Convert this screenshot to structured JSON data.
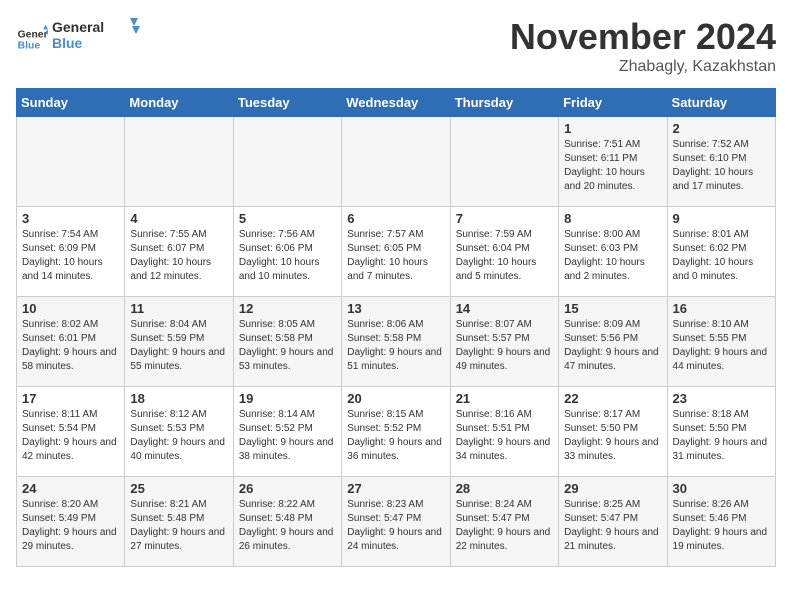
{
  "logo": {
    "line1": "General",
    "line2": "Blue"
  },
  "title": "November 2024",
  "location": "Zhabagly, Kazakhstan",
  "headers": [
    "Sunday",
    "Monday",
    "Tuesday",
    "Wednesday",
    "Thursday",
    "Friday",
    "Saturday"
  ],
  "weeks": [
    [
      {
        "day": "",
        "detail": ""
      },
      {
        "day": "",
        "detail": ""
      },
      {
        "day": "",
        "detail": ""
      },
      {
        "day": "",
        "detail": ""
      },
      {
        "day": "",
        "detail": ""
      },
      {
        "day": "1",
        "detail": "Sunrise: 7:51 AM\nSunset: 6:11 PM\nDaylight: 10 hours and 20 minutes."
      },
      {
        "day": "2",
        "detail": "Sunrise: 7:52 AM\nSunset: 6:10 PM\nDaylight: 10 hours and 17 minutes."
      }
    ],
    [
      {
        "day": "3",
        "detail": "Sunrise: 7:54 AM\nSunset: 6:09 PM\nDaylight: 10 hours and 14 minutes."
      },
      {
        "day": "4",
        "detail": "Sunrise: 7:55 AM\nSunset: 6:07 PM\nDaylight: 10 hours and 12 minutes."
      },
      {
        "day": "5",
        "detail": "Sunrise: 7:56 AM\nSunset: 6:06 PM\nDaylight: 10 hours and 10 minutes."
      },
      {
        "day": "6",
        "detail": "Sunrise: 7:57 AM\nSunset: 6:05 PM\nDaylight: 10 hours and 7 minutes."
      },
      {
        "day": "7",
        "detail": "Sunrise: 7:59 AM\nSunset: 6:04 PM\nDaylight: 10 hours and 5 minutes."
      },
      {
        "day": "8",
        "detail": "Sunrise: 8:00 AM\nSunset: 6:03 PM\nDaylight: 10 hours and 2 minutes."
      },
      {
        "day": "9",
        "detail": "Sunrise: 8:01 AM\nSunset: 6:02 PM\nDaylight: 10 hours and 0 minutes."
      }
    ],
    [
      {
        "day": "10",
        "detail": "Sunrise: 8:02 AM\nSunset: 6:01 PM\nDaylight: 9 hours and 58 minutes."
      },
      {
        "day": "11",
        "detail": "Sunrise: 8:04 AM\nSunset: 5:59 PM\nDaylight: 9 hours and 55 minutes."
      },
      {
        "day": "12",
        "detail": "Sunrise: 8:05 AM\nSunset: 5:58 PM\nDaylight: 9 hours and 53 minutes."
      },
      {
        "day": "13",
        "detail": "Sunrise: 8:06 AM\nSunset: 5:58 PM\nDaylight: 9 hours and 51 minutes."
      },
      {
        "day": "14",
        "detail": "Sunrise: 8:07 AM\nSunset: 5:57 PM\nDaylight: 9 hours and 49 minutes."
      },
      {
        "day": "15",
        "detail": "Sunrise: 8:09 AM\nSunset: 5:56 PM\nDaylight: 9 hours and 47 minutes."
      },
      {
        "day": "16",
        "detail": "Sunrise: 8:10 AM\nSunset: 5:55 PM\nDaylight: 9 hours and 44 minutes."
      }
    ],
    [
      {
        "day": "17",
        "detail": "Sunrise: 8:11 AM\nSunset: 5:54 PM\nDaylight: 9 hours and 42 minutes."
      },
      {
        "day": "18",
        "detail": "Sunrise: 8:12 AM\nSunset: 5:53 PM\nDaylight: 9 hours and 40 minutes."
      },
      {
        "day": "19",
        "detail": "Sunrise: 8:14 AM\nSunset: 5:52 PM\nDaylight: 9 hours and 38 minutes."
      },
      {
        "day": "20",
        "detail": "Sunrise: 8:15 AM\nSunset: 5:52 PM\nDaylight: 9 hours and 36 minutes."
      },
      {
        "day": "21",
        "detail": "Sunrise: 8:16 AM\nSunset: 5:51 PM\nDaylight: 9 hours and 34 minutes."
      },
      {
        "day": "22",
        "detail": "Sunrise: 8:17 AM\nSunset: 5:50 PM\nDaylight: 9 hours and 33 minutes."
      },
      {
        "day": "23",
        "detail": "Sunrise: 8:18 AM\nSunset: 5:50 PM\nDaylight: 9 hours and 31 minutes."
      }
    ],
    [
      {
        "day": "24",
        "detail": "Sunrise: 8:20 AM\nSunset: 5:49 PM\nDaylight: 9 hours and 29 minutes."
      },
      {
        "day": "25",
        "detail": "Sunrise: 8:21 AM\nSunset: 5:48 PM\nDaylight: 9 hours and 27 minutes."
      },
      {
        "day": "26",
        "detail": "Sunrise: 8:22 AM\nSunset: 5:48 PM\nDaylight: 9 hours and 26 minutes."
      },
      {
        "day": "27",
        "detail": "Sunrise: 8:23 AM\nSunset: 5:47 PM\nDaylight: 9 hours and 24 minutes."
      },
      {
        "day": "28",
        "detail": "Sunrise: 8:24 AM\nSunset: 5:47 PM\nDaylight: 9 hours and 22 minutes."
      },
      {
        "day": "29",
        "detail": "Sunrise: 8:25 AM\nSunset: 5:47 PM\nDaylight: 9 hours and 21 minutes."
      },
      {
        "day": "30",
        "detail": "Sunrise: 8:26 AM\nSunset: 5:46 PM\nDaylight: 9 hours and 19 minutes."
      }
    ]
  ]
}
